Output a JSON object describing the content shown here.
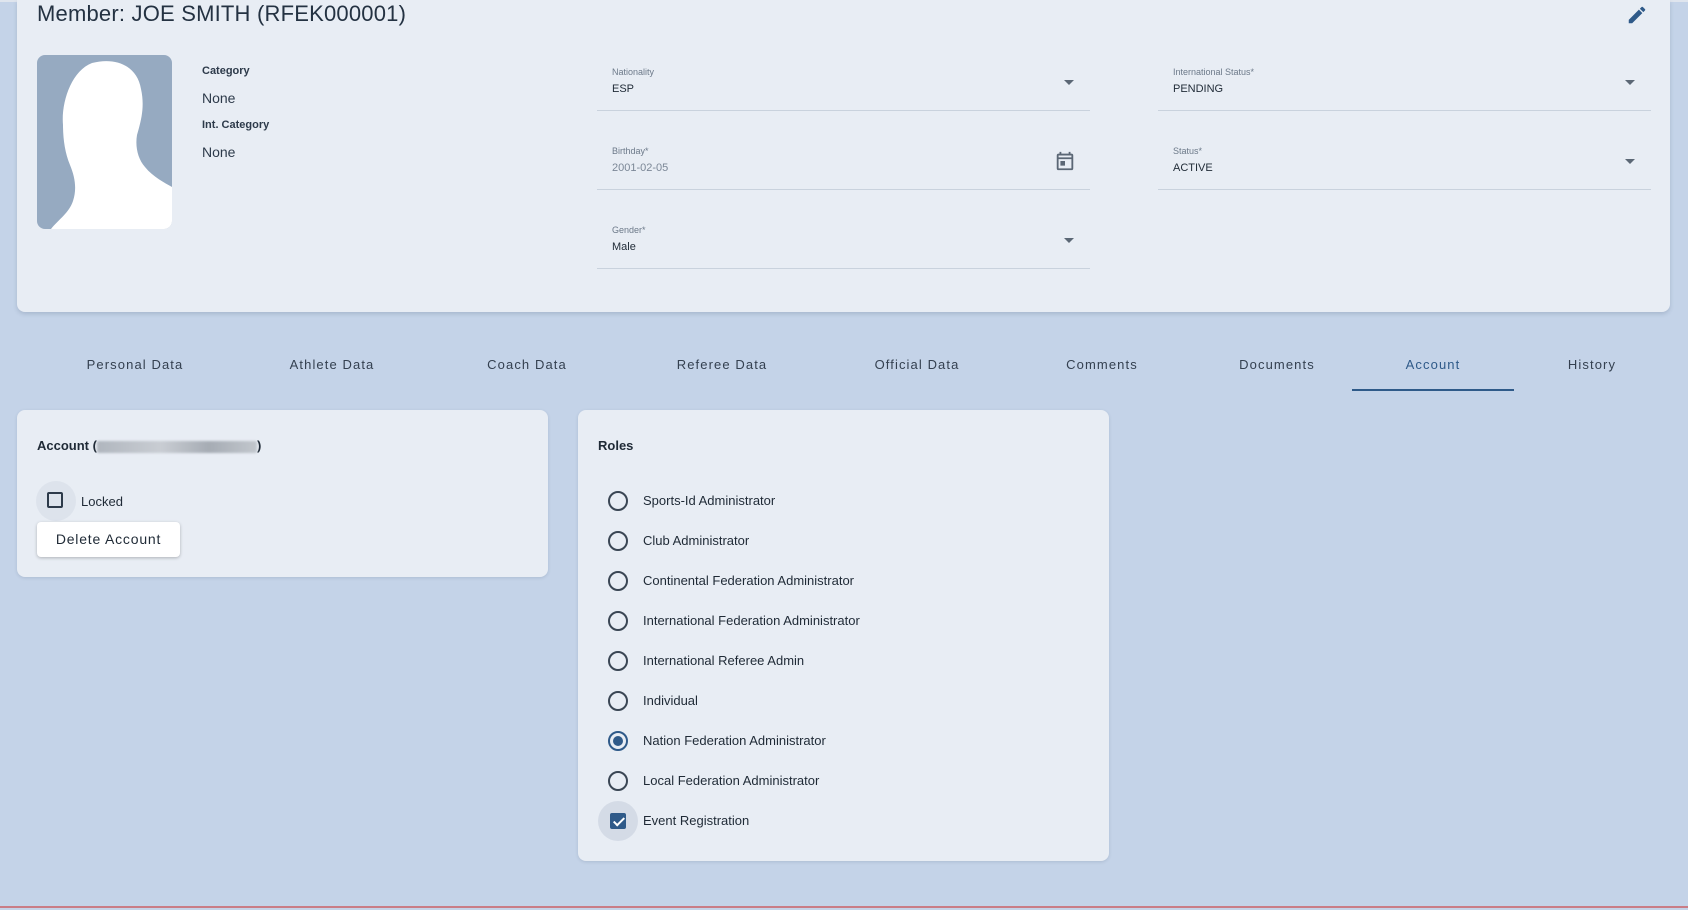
{
  "header": {
    "title": "Member: JOE SMITH (RFEK000001)",
    "edit_icon": "pencil-icon"
  },
  "profile": {
    "category_label": "Category",
    "category_value": "None",
    "int_category_label": "Int. Category",
    "int_category_value": "None"
  },
  "fields": {
    "nationality": {
      "label": "Nationality",
      "value": "ESP"
    },
    "birthday": {
      "label": "Birthday*",
      "value": "2001-02-05"
    },
    "gender": {
      "label": "Gender*",
      "value": "Male"
    },
    "international_status": {
      "label": "International Status*",
      "value": "PENDING"
    },
    "status": {
      "label": "Status*",
      "value": "ACTIVE"
    }
  },
  "tabs": [
    {
      "label": "Personal Data"
    },
    {
      "label": "Athlete Data"
    },
    {
      "label": "Coach Data"
    },
    {
      "label": "Referee Data"
    },
    {
      "label": "Official Data"
    },
    {
      "label": "Comments"
    },
    {
      "label": "Documents"
    },
    {
      "label": "Account",
      "active": true
    },
    {
      "label": "History"
    }
  ],
  "account": {
    "title_prefix": "Account (",
    "title_suffix": ")",
    "locked_label": "Locked",
    "locked_checked": false,
    "delete_button": "Delete Account"
  },
  "roles": {
    "title": "Roles",
    "items": [
      {
        "label": "Sports-Id Administrator",
        "selected": false
      },
      {
        "label": "Club Administrator",
        "selected": false
      },
      {
        "label": "Continental Federation Administrator",
        "selected": false
      },
      {
        "label": "International Federation Administrator",
        "selected": false
      },
      {
        "label": "International Referee Admin",
        "selected": false
      },
      {
        "label": "Individual",
        "selected": false
      },
      {
        "label": "Nation Federation Administrator",
        "selected": true
      },
      {
        "label": "Local Federation Administrator",
        "selected": false
      }
    ],
    "event_registration": {
      "label": "Event Registration",
      "checked": true
    }
  },
  "colors": {
    "background": "#c4d3e8",
    "card": "#e8edf4",
    "accent": "#2f5a89",
    "avatar_bg": "#96aac1"
  }
}
